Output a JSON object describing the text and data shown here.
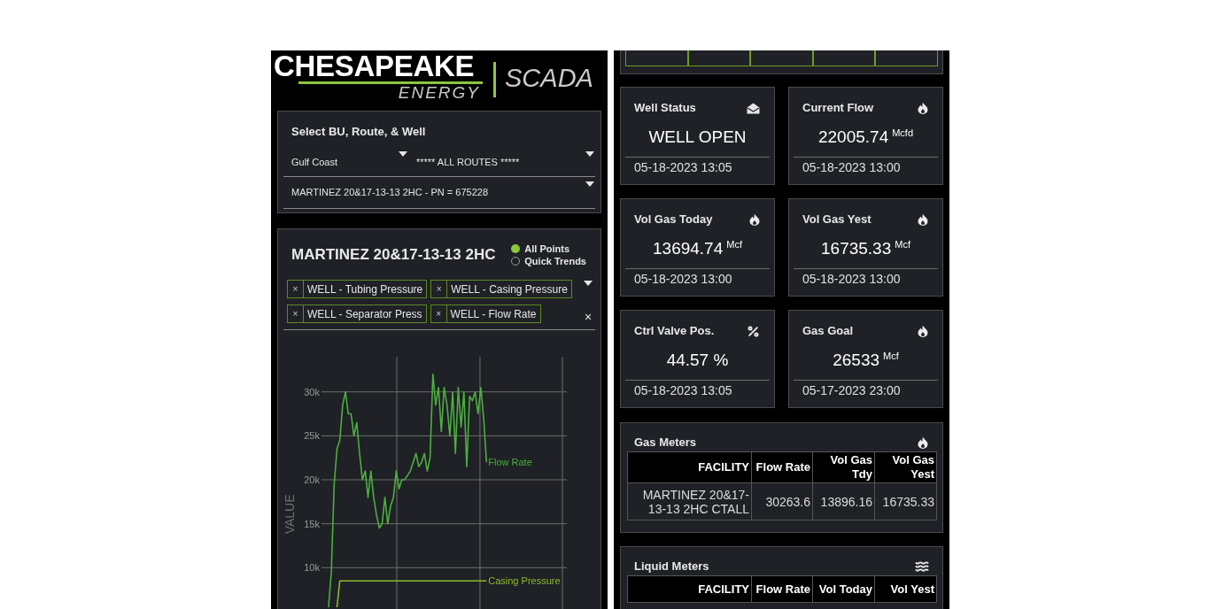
{
  "logo": {
    "name": "CHESAPEAKE",
    "subtitle": "ENERGY",
    "product": "SCADA"
  },
  "selector": {
    "title": "Select BU, Route, & Well",
    "business_unit": "Gulf Coast",
    "route": "***** ALL ROUTES *****",
    "well": "MARTINEZ 20&17-13-13 2HC - PN = 675228"
  },
  "trend": {
    "title": "MARTINEZ 20&17-13-13 2HC",
    "modes": [
      {
        "label": "All Points",
        "selected": true
      },
      {
        "label": "Quick Trends",
        "selected": false
      }
    ],
    "tags": [
      {
        "remove": "×",
        "label": "WELL - Tubing Pressure"
      },
      {
        "remove": "×",
        "label": "WELL - Casing Pressure"
      },
      {
        "remove": "×",
        "label": "WELL - Separator Press"
      },
      {
        "remove": "×",
        "label": "WELL - Flow Rate"
      }
    ],
    "clear": "×",
    "chart_data": {
      "type": "line",
      "ylabel": "VALUE",
      "grid": true,
      "categories": [
        null,
        null,
        null,
        null,
        null,
        null,
        null,
        null,
        null,
        null,
        null,
        null,
        null,
        null,
        null,
        null,
        null,
        null,
        null,
        null,
        null,
        null,
        null,
        null,
        null,
        null,
        null,
        null,
        null,
        null,
        null,
        null,
        null,
        null,
        null,
        null,
        null,
        null,
        null,
        null,
        null,
        null,
        null,
        null,
        null,
        null,
        null,
        null,
        null,
        null,
        null,
        null,
        null,
        null,
        null,
        null,
        null,
        null,
        null,
        null,
        null,
        null,
        null,
        null,
        null,
        null,
        null,
        null,
        null,
        null,
        null,
        null,
        null,
        null,
        null,
        null,
        null,
        null,
        null,
        null,
        null,
        null,
        null,
        null,
        null,
        null,
        null
      ],
      "series": [
        {
          "name": "Flow Rate",
          "color": "#4caf3f",
          "values": [
            null,
            null,
            5500,
            9500,
            19500,
            23500,
            24500,
            28500,
            30000,
            27500,
            27500,
            25000,
            26500,
            23000,
            20000,
            21000,
            18000,
            21000,
            18000,
            16000,
            14500,
            15000,
            18000,
            15000,
            17000,
            18000,
            21000,
            19000,
            20000,
            20000,
            20500,
            21000,
            22000,
            23000,
            21500,
            22000,
            23000,
            21000,
            22500,
            32000,
            28500,
            30500,
            25500,
            30500,
            28500,
            25000,
            30000,
            23000,
            30500,
            26000,
            30000,
            21500,
            29500,
            29000,
            30000,
            27500,
            30500,
            27000,
            22000,
            null,
            null,
            null,
            null,
            null,
            null,
            null,
            null,
            null,
            null,
            null,
            null,
            null,
            null,
            null,
            null,
            null,
            null,
            null,
            null,
            null,
            null,
            null,
            null,
            null,
            null,
            null,
            null
          ]
        },
        {
          "name": "Casing Pressure",
          "color": "#8dbb2c",
          "values": [
            null,
            null,
            null,
            null,
            null,
            5500,
            8500,
            8500,
            8500,
            8500,
            8500,
            8500,
            8500,
            8500,
            8500,
            8500,
            8500,
            8500,
            8500,
            8500,
            8500,
            8500,
            8500,
            8500,
            8500,
            8500,
            8500,
            8500,
            8500,
            8500,
            8500,
            8500,
            8500,
            8500,
            8500,
            8500,
            8500,
            8500,
            8500,
            8500,
            8500,
            8500,
            8500,
            8500,
            8500,
            8500,
            8500,
            8500,
            8500,
            8500,
            8500,
            8500,
            8500,
            8500,
            8500,
            8500,
            8500,
            8500,
            8500,
            null,
            null,
            null,
            null,
            null,
            null,
            null,
            null,
            null,
            null,
            null,
            null,
            null,
            null,
            null,
            null,
            null,
            null,
            null,
            null,
            null,
            null,
            null,
            null,
            null,
            null,
            null,
            null
          ]
        }
      ],
      "ylim": [
        5300,
        34000
      ],
      "yticks": [
        {
          "value": 10000,
          "label": "10k"
        },
        {
          "value": 15000,
          "label": "15k"
        },
        {
          "value": 20000,
          "label": "20k"
        },
        {
          "value": 25000,
          "label": "25k"
        },
        {
          "value": 30000,
          "label": "30k"
        }
      ]
    }
  },
  "metrics": [
    {
      "kind": "status",
      "title": "Well Status",
      "value": "WELL OPEN",
      "timestamp": "05-18-2023 13:05"
    },
    {
      "kind": "gas",
      "title": "Current Flow",
      "value": "22005.74",
      "unit": "Mcfd",
      "timestamp": "05-18-2023 13:00"
    },
    {
      "kind": "gas",
      "title": "Vol Gas Today",
      "value": "13694.74",
      "unit": "Mcf",
      "timestamp": "05-18-2023 13:00"
    },
    {
      "kind": "gas",
      "title": "Vol Gas Yest",
      "value": "16735.33",
      "unit": "Mcf",
      "timestamp": "05-18-2023 13:00"
    },
    {
      "kind": "percent",
      "title": "Ctrl Valve Pos.",
      "value": "44.57 %",
      "timestamp": "05-18-2023 13:05"
    },
    {
      "kind": "gas",
      "title": "Gas Goal",
      "value": "26533",
      "unit": "Mcf",
      "timestamp": "05-17-2023 23:00"
    }
  ],
  "gas_meters": {
    "title": "Gas Meters",
    "columns": [
      "FACILITY",
      "Flow Rate",
      "Vol Gas Tdy",
      "Vol Gas Yest"
    ],
    "rows": [
      [
        "MARTINEZ 20&17-13-13 2HC CTALL",
        "30263.6",
        "13896.16",
        "16735.33"
      ]
    ]
  },
  "liquid_meters": {
    "title": "Liquid Meters",
    "columns": [
      "FACILITY",
      "Flow Rate",
      "Vol Today",
      "Vol Yest"
    ]
  }
}
